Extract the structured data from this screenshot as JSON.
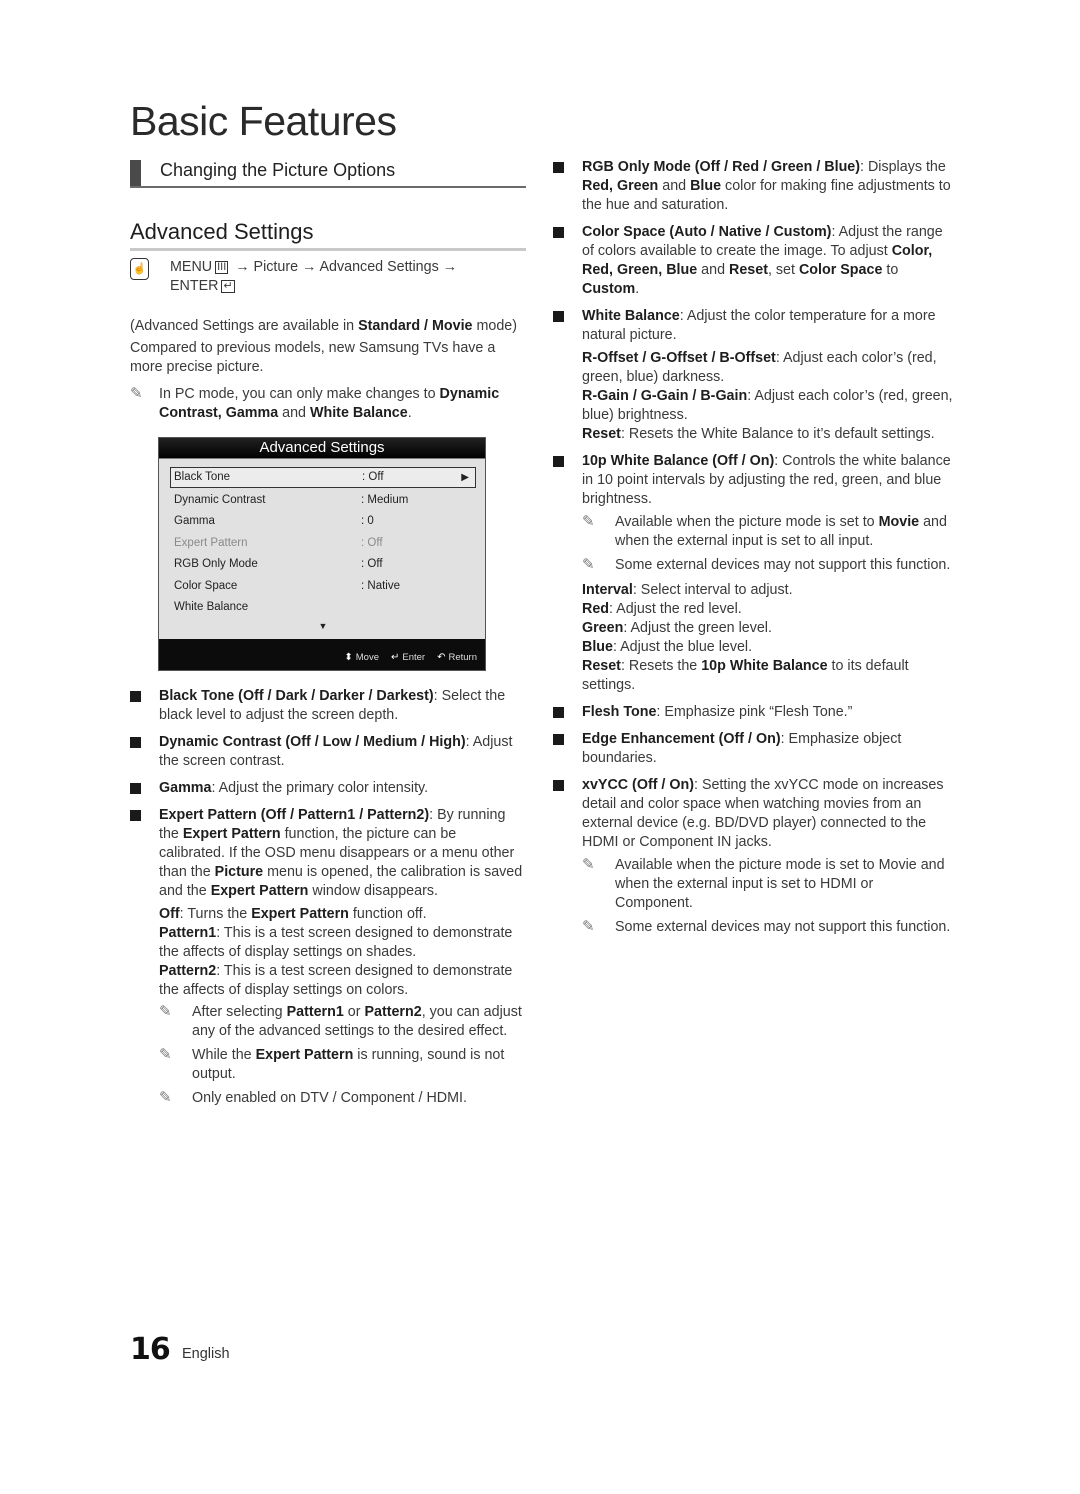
{
  "page": {
    "title": "Basic Features",
    "section": "Changing the Picture Options",
    "subtitle": "Advanced Settings",
    "page_number": "16",
    "language": "English"
  },
  "left": {
    "menu_path": {
      "icon": "remote-hand-icon",
      "menu": "MENU",
      "menu_glyph": "III",
      "arrow": "→",
      "picture": "Picture",
      "advanced": "Advanced Settings",
      "enter": "ENTER",
      "enter_glyph": "↵"
    },
    "availability": {
      "pre": "(Advanced Settings are available in ",
      "bold": "Standard / Movie",
      "post": " mode)"
    },
    "intro": "Compared to previous models, new Samsung TVs have a more precise picture.",
    "pc_note": {
      "pre": "In PC mode, you can only make changes to ",
      "b1": "Dynamic Contrast, Gamma",
      "mid": " and ",
      "b2": "White Balance",
      "post": "."
    },
    "osd": {
      "title": "Advanced Settings",
      "rows": [
        {
          "label": "Black Tone",
          "value": ": Off",
          "state": "selected"
        },
        {
          "label": "Dynamic Contrast",
          "value": ": Medium",
          "state": "normal"
        },
        {
          "label": "Gamma",
          "value": ": 0",
          "state": "normal"
        },
        {
          "label": "Expert Pattern",
          "value": ": Off",
          "state": "disabled"
        },
        {
          "label": "RGB Only Mode",
          "value": ": Off",
          "state": "normal"
        },
        {
          "label": "Color Space",
          "value": ": Native",
          "state": "normal"
        },
        {
          "label": "White Balance",
          "value": "",
          "state": "normal"
        }
      ],
      "more_indicator": "▼",
      "right_arrow": "▶",
      "footer": {
        "move_icon": "⬍",
        "move": "Move",
        "enter_icon": "↵",
        "enter": "Enter",
        "return_icon": "↶",
        "return": "Return"
      }
    },
    "bullets": [
      {
        "bold": "Black Tone (Off / Dark / Darker / Darkest)",
        "text": ": Select the black level to adjust the screen depth."
      },
      {
        "bold": "Dynamic Contrast (Off / Low / Medium / High)",
        "text": ": Adjust the screen contrast."
      },
      {
        "bold": "Gamma",
        "text": ": Adjust the primary color intensity."
      }
    ],
    "expert": {
      "bold": "Expert Pattern (Off / Pattern1 / Pattern2)",
      "t1": ": By running the ",
      "b1": "Expert Pattern",
      "t2": " function, the picture can be calibrated. If the OSD menu disappears or a menu other than the ",
      "b2": "Picture",
      "t3": " menu is opened, the calibration is saved and the ",
      "b3": "Expert Pattern",
      "t4": " window disappears.",
      "off": {
        "bold": "Off",
        "pre": ": Turns the ",
        "b": "Expert Pattern",
        "post": " function off."
      },
      "p1": {
        "bold": "Pattern1",
        "text": ": This is a test screen designed to demonstrate the affects of display settings on shades."
      },
      "p2": {
        "bold": "Pattern2",
        "text": ": This is a test screen designed to demonstrate the affects of display settings on colors."
      },
      "notes": {
        "n1": {
          "pre": "After selecting ",
          "b1": "Pattern1",
          "mid": " or ",
          "b2": "Pattern2",
          "post": ", you can adjust any of the advanced settings to the desired effect."
        },
        "n2": {
          "pre": "While the ",
          "b": "Expert Pattern",
          "post": " is running, sound is not output."
        },
        "n3": "Only enabled on DTV / Component / HDMI."
      }
    }
  },
  "right": {
    "rgb": {
      "bold": "RGB Only Mode (Off / Red / Green / Blue)",
      "t1": ": Displays the ",
      "b1": "Red, Green",
      "t2": " and ",
      "b2": "Blue",
      "t3": " color for making fine adjustments to the hue and saturation."
    },
    "color_space": {
      "bold": "Color Space (Auto / Native / Custom)",
      "t1": ": Adjust the range of colors available to create the image. To adjust ",
      "b1": "Color, Red, Green, Blue",
      "t2": " and ",
      "b2": "Reset",
      "t3": ", set ",
      "b3": "Color Space",
      "t4": " to ",
      "b4": "Custom",
      "t5": "."
    },
    "white_balance": {
      "bold": "White Balance",
      "text": ": Adjust the color temperature for a more natural picture.",
      "offset": {
        "bold": "R-Offset / G-Offset / B-Offset",
        "text": ": Adjust each color’s (red, green, blue) darkness."
      },
      "gain": {
        "bold": "R-Gain / G-Gain / B-Gain",
        "text": ": Adjust each color’s (red, green, blue) brightness."
      },
      "reset": {
        "bold": "Reset",
        "text": ": Resets the White Balance to it’s default settings."
      }
    },
    "wb10": {
      "bold": "10p White Balance (Off / On)",
      "text": ": Controls the white balance in 10 point intervals by adjusting the red, green, and blue brightness.",
      "note1": {
        "pre": "Available when the picture mode is set to ",
        "b": "Movie",
        "post": " and when the external input is set to all input."
      },
      "note2": "Some external devices may not support this function.",
      "interval": {
        "bold": "Interval",
        "text": ": Select interval to adjust."
      },
      "red": {
        "bold": "Red",
        "text": ": Adjust the red level."
      },
      "green": {
        "bold": "Green",
        "text": ": Adjust the green level."
      },
      "blue": {
        "bold": "Blue",
        "text": ": Adjust the blue level."
      },
      "reset": {
        "bold": "Reset",
        "pre": ": Resets the ",
        "b": "10p White Balance",
        "post": " to its default settings."
      }
    },
    "flesh": {
      "bold": "Flesh Tone",
      "text": ": Emphasize pink “Flesh Tone.”"
    },
    "edge": {
      "bold": "Edge Enhancement (Off / On)",
      "text": ": Emphasize object boundaries."
    },
    "xvycc": {
      "bold": "xvYCC (Off / On)",
      "text": ": Setting the xvYCC mode on increases detail and color space when watching movies from an external device (e.g. BD/DVD player) connected to the HDMI or Component IN jacks.",
      "note1": "Available when the picture mode is set to Movie and when the external input is set to HDMI or Component.",
      "note2": "Some external devices may not support this function."
    },
    "pencil_glyph": "✎"
  }
}
